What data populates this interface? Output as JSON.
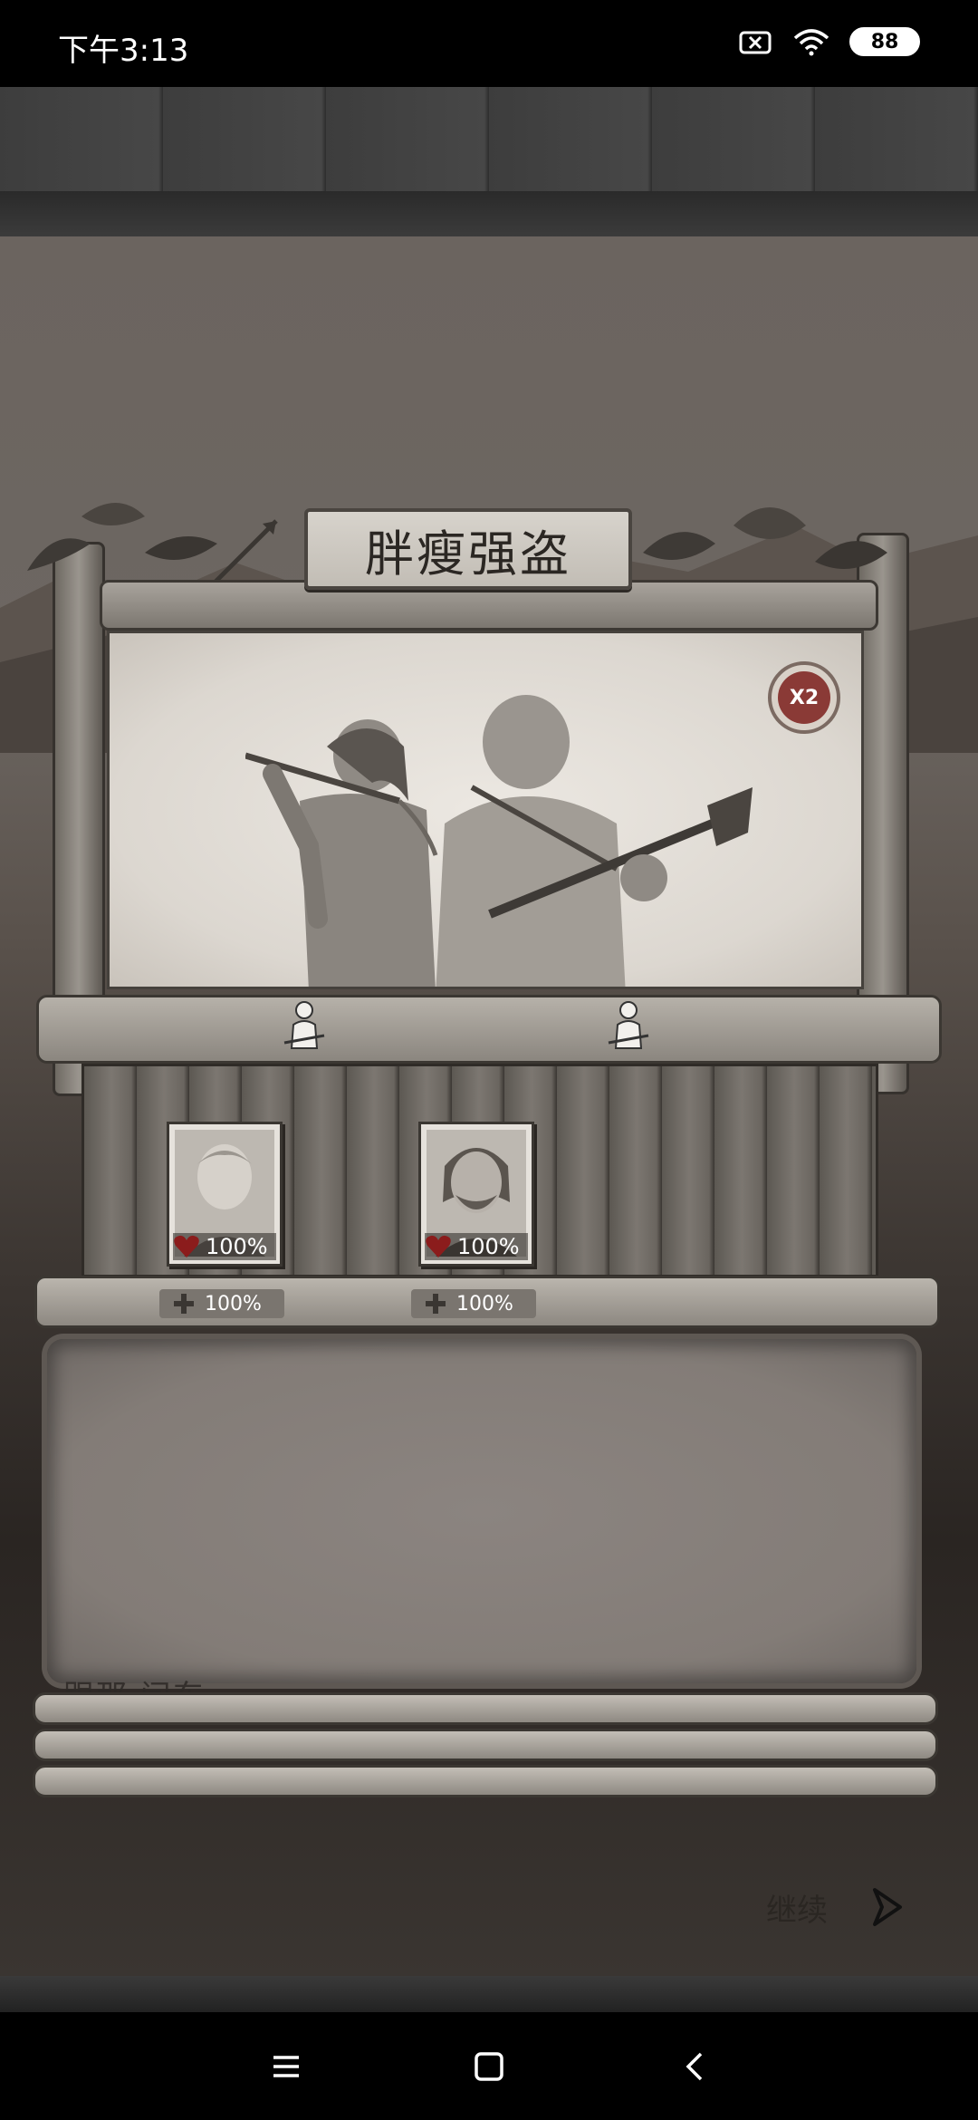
{
  "status_bar": {
    "time": "下午3:13",
    "battery": "88"
  },
  "encounter": {
    "title": "胖瘦强盗",
    "multiplier": "X2"
  },
  "party": [
    {
      "hp": "100%",
      "stat": "100%"
    },
    {
      "hp": "100%",
      "stat": "100%"
    }
  ],
  "log_partial_text": "跟那 问东",
  "continue": {
    "label": "继续"
  },
  "colors": {
    "badge": "#8a3a36",
    "heart": "#8b1c1c"
  }
}
